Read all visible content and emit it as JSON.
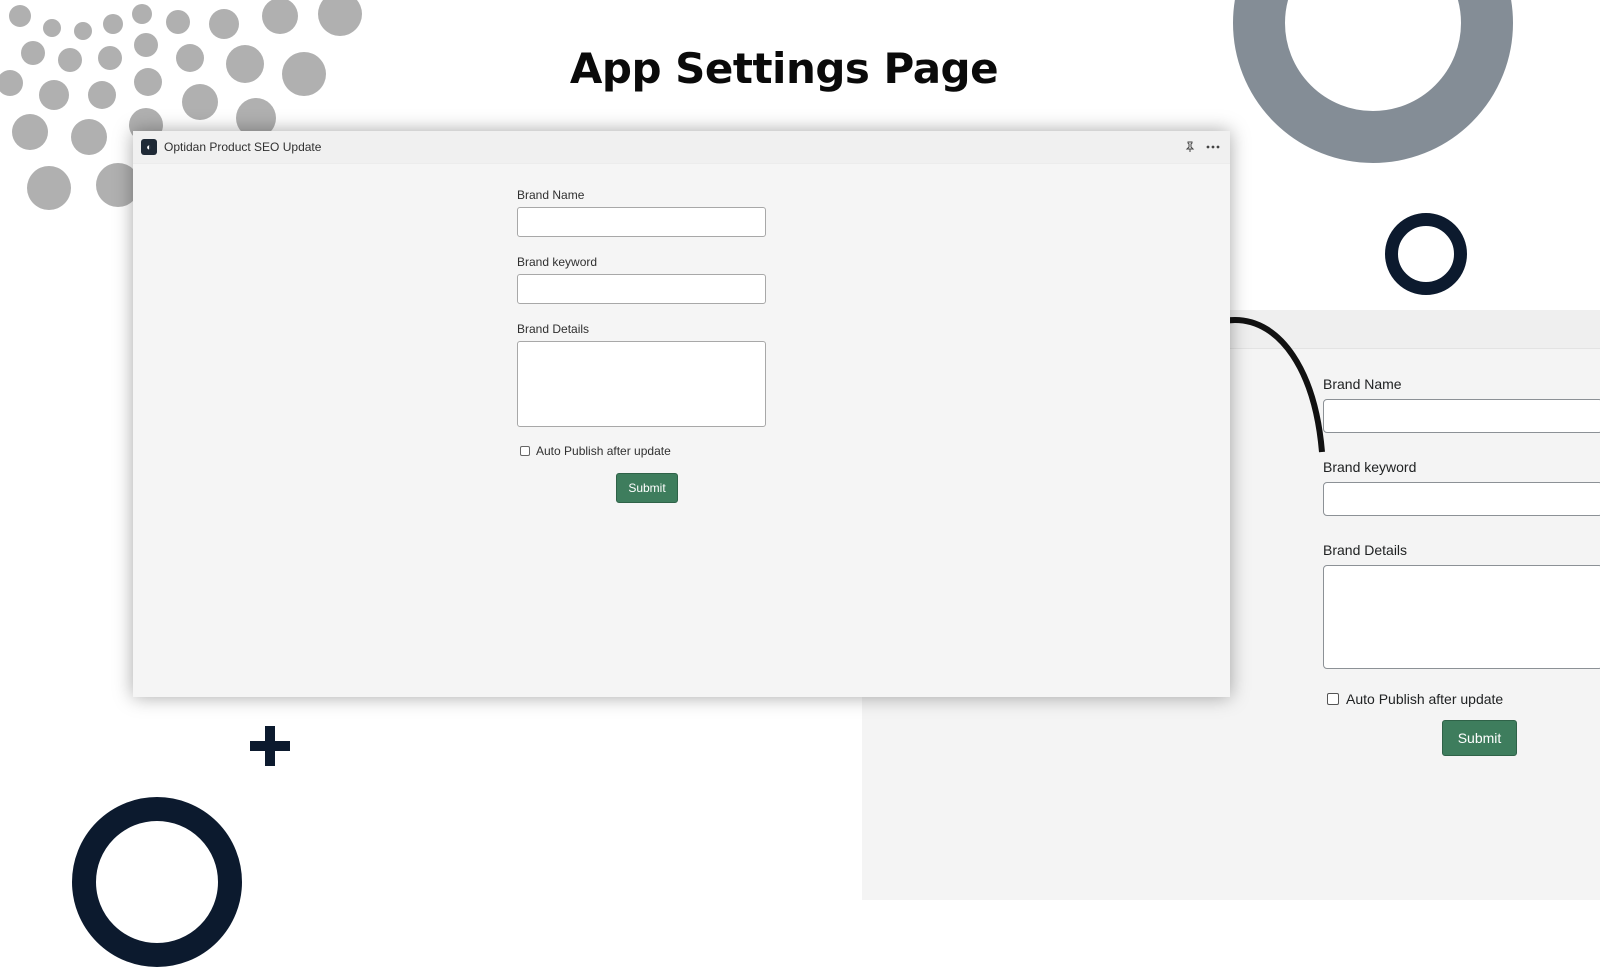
{
  "page": {
    "headline": "App Settings Page"
  },
  "app_window": {
    "title": "Optidan Product SEO Update",
    "logo_text": "◐",
    "pin_icon": "pin-icon",
    "more_icon": "more-horizontal-icon"
  },
  "form": {
    "brand_name_label": "Brand Name",
    "brand_name_value": "",
    "brand_keyword_label": "Brand keyword",
    "brand_keyword_value": "",
    "brand_details_label": "Brand Details",
    "brand_details_value": "",
    "auto_publish_label": "Auto Publish after update",
    "auto_publish_checked": false,
    "submit_label": "Submit"
  },
  "zoom": {
    "brand_name_label": "Brand Name",
    "brand_keyword_label": "Brand keyword",
    "brand_details_label": "Brand Details",
    "auto_publish_label": "Auto Publish after update",
    "submit_label": "Submit"
  },
  "colors": {
    "primary_button": "#3e7d5d",
    "ring_gray": "#848d96",
    "navy": "#0c1a2e"
  }
}
